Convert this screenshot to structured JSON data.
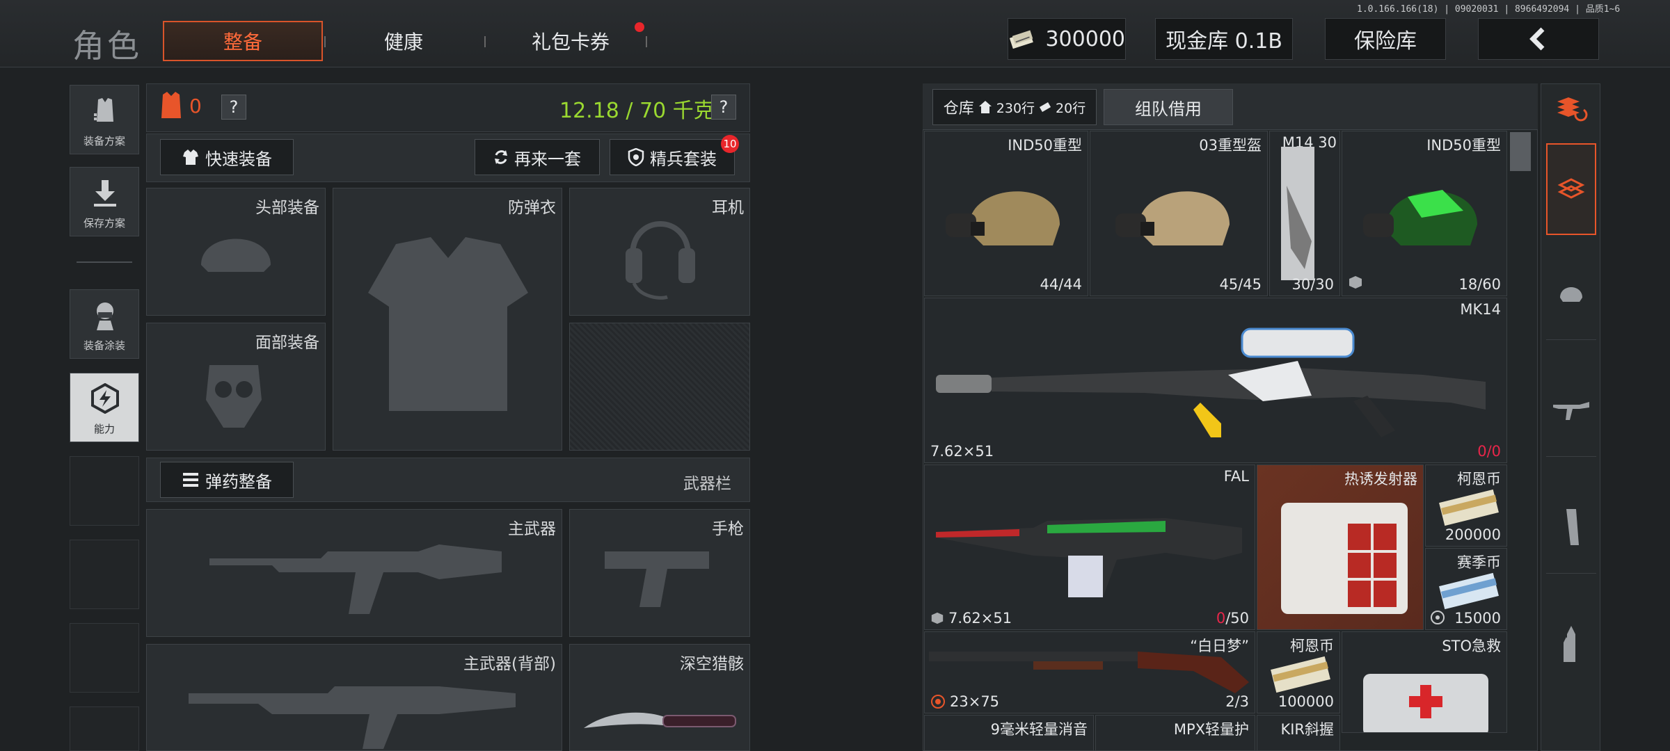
{
  "version": "1.0.166.166(18) | 09020031 | 8966492094 | 品质1~6",
  "header": {
    "title": "角色",
    "tabs": [
      {
        "label": "整备",
        "active": true
      },
      {
        "label": "健康",
        "active": false
      },
      {
        "label": "礼包卡券",
        "active": false,
        "badge": true
      }
    ],
    "currency_amount": "300000",
    "cash_vault": "现金库 0.1B",
    "insurance": "保险库",
    "back_icon": "chevron-left-icon"
  },
  "left_nav": [
    {
      "label": "装备方案",
      "icon": "vest-plan-icon"
    },
    {
      "label": "保存方案",
      "icon": "download-icon"
    },
    {
      "label": "装备涂装",
      "icon": "operator-skin-icon"
    },
    {
      "label": "能力",
      "icon": "ability-icon",
      "active": true
    }
  ],
  "loadout": {
    "armor_count": "0",
    "weight": "12.18 / 70 千克",
    "quick_equip": "快速装备",
    "again_set": "再来一套",
    "elite_set": "精兵套装",
    "elite_badge": "10",
    "slots": {
      "head": "头部装备",
      "vest": "防弹衣",
      "headset": "耳机",
      "face": "面部装备"
    },
    "ammo_equip": "弹药整备",
    "weapon_bar": "武器栏",
    "weapon_slots": {
      "primary": "主武器",
      "pistol": "手枪",
      "primary_back": "主武器(背部)",
      "melee": "深空猎骸"
    }
  },
  "storage": {
    "warehouse": "仓库",
    "warehouse_rows": "230行",
    "extra_rows": "20行",
    "team_borrow": "组队借用",
    "items": {
      "helmet1": {
        "name": "IND50重型",
        "count": "44/44"
      },
      "helmet2": {
        "name": "03重型盔",
        "count": "45/45"
      },
      "m1430": {
        "name": "M14 30",
        "count": "30/30"
      },
      "helmet3": {
        "name": "IND50重型",
        "count": "18/60"
      },
      "mk14": {
        "name": "MK14",
        "caliber": "7.62×51",
        "ammo_cur": "0",
        "ammo_max": "/0"
      },
      "fal": {
        "name": "FAL",
        "caliber": "7.62×51",
        "ammo_cur": "0",
        "ammo_max": "/50"
      },
      "launcher": {
        "name": "热诱发射器"
      },
      "coin1": {
        "name": "柯恩币",
        "count": "200000"
      },
      "coin2": {
        "name": "赛季币",
        "count": "15000"
      },
      "shotgun": {
        "name": "“白日梦”",
        "caliber": "23×75",
        "count": "2/3"
      },
      "coin3": {
        "name": "柯恩币",
        "count": "100000"
      },
      "medkit": {
        "name": "STO急救"
      },
      "bottom1": {
        "name": "9毫米轻量消音"
      },
      "bottom2": {
        "name": "MPX轻量护"
      },
      "bottom3": {
        "name": "KIR斜握"
      }
    }
  },
  "right_tabs": [
    "all-items-icon",
    "backpack-icon",
    "helmet-icon",
    "rifle-icon",
    "magazine-icon",
    "ammo-icon"
  ]
}
